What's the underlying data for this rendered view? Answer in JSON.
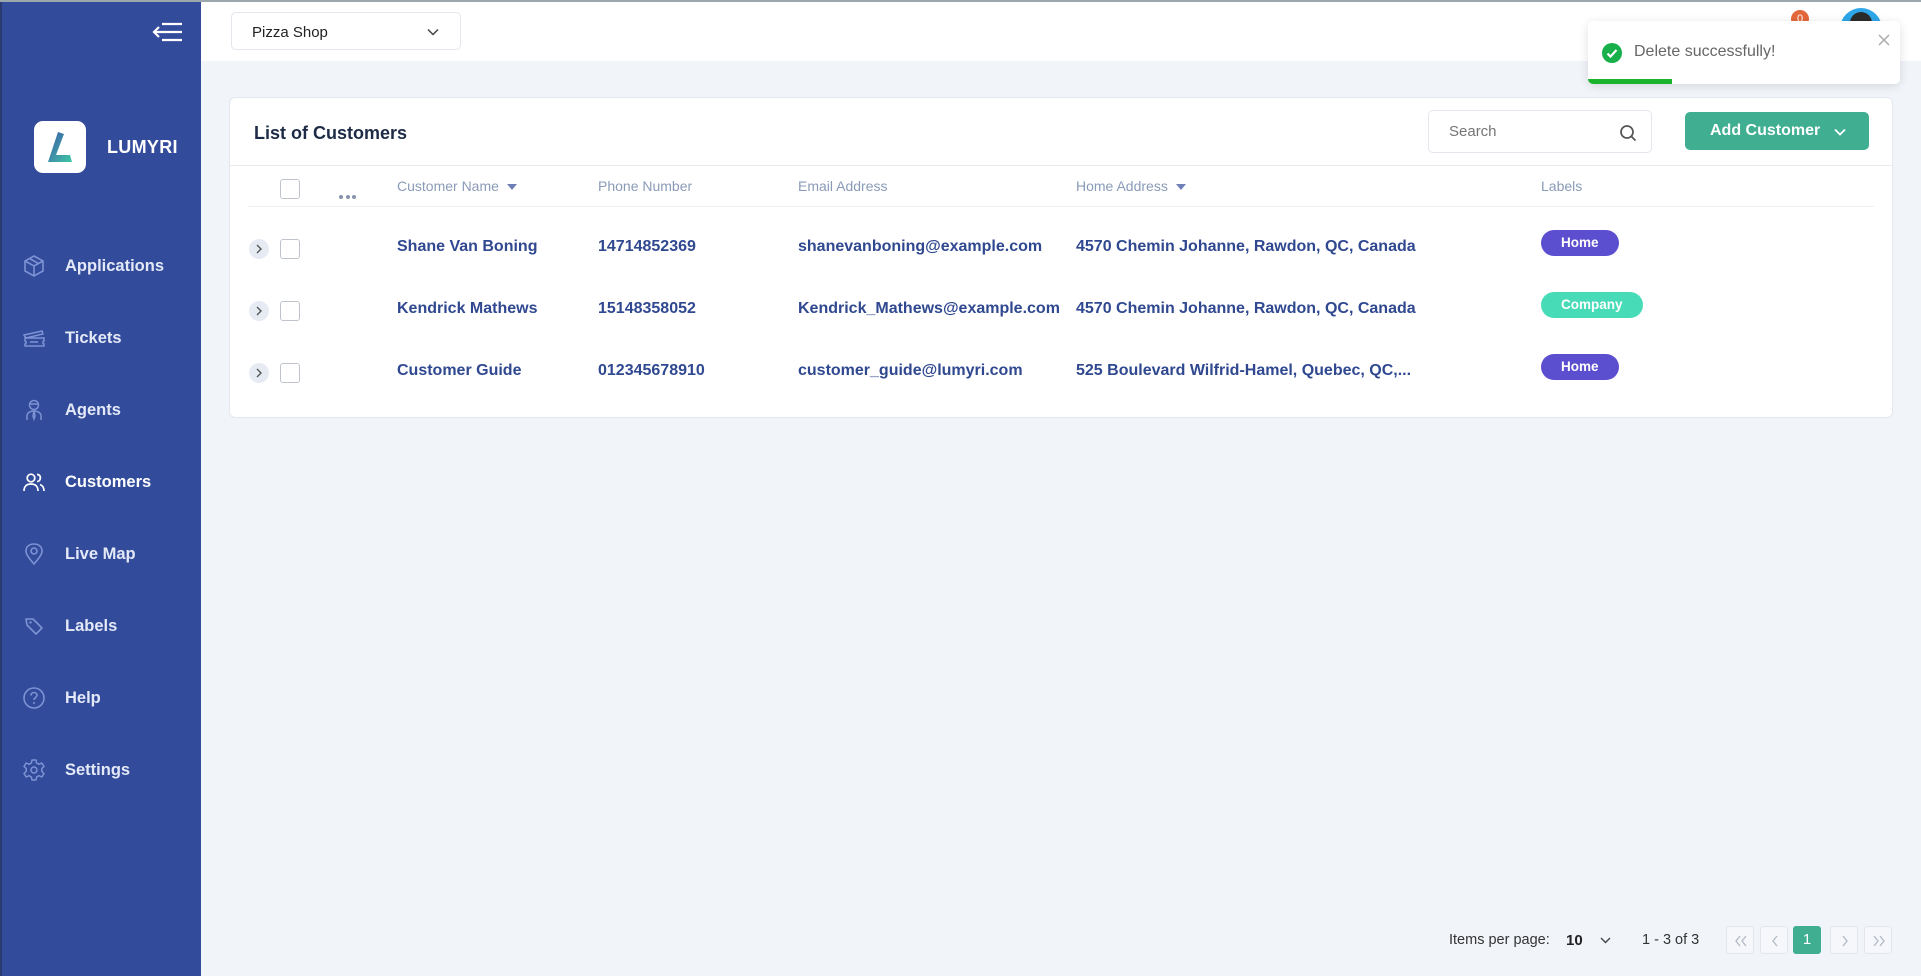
{
  "app": {
    "brand": "LUMYRI"
  },
  "sidebar": {
    "items": [
      {
        "label": "Applications",
        "icon": "box-icon",
        "active": false
      },
      {
        "label": "Tickets",
        "icon": "ticket-icon",
        "active": false
      },
      {
        "label": "Agents",
        "icon": "agent-icon",
        "active": false
      },
      {
        "label": "Customers",
        "icon": "users-icon",
        "active": true
      },
      {
        "label": "Live Map",
        "icon": "map-pin-icon",
        "active": false
      },
      {
        "label": "Labels",
        "icon": "tag-icon",
        "active": false
      },
      {
        "label": "Help",
        "icon": "help-icon",
        "active": false
      },
      {
        "label": "Settings",
        "icon": "gear-icon",
        "active": false
      }
    ]
  },
  "header": {
    "shop_select": "Pizza Shop",
    "notification_count": "0"
  },
  "toast": {
    "message": "Delete successfully!",
    "status": "success",
    "progress": 0.27
  },
  "card": {
    "title": "List of Customers",
    "search_placeholder": "Search",
    "add_button": "Add Customer",
    "columns": {
      "name": "Customer Name",
      "phone": "Phone Number",
      "email": "Email Address",
      "address": "Home Address",
      "labels": "Labels"
    },
    "rows": [
      {
        "name": "Shane Van Boning",
        "phone": "14714852369",
        "email": "shanevanboning@example.com",
        "address": "4570 Chemin Johanne, Rawdon, QC, Canada",
        "label": "Home",
        "label_color": "#5b4fcf"
      },
      {
        "name": "Kendrick Mathews",
        "phone": "15148358052",
        "email": "Kendrick_Mathews@example.com",
        "address": "4570 Chemin Johanne, Rawdon, QC, Canada",
        "label": "Company",
        "label_color": "#47dbb8"
      },
      {
        "name": "Customer Guide",
        "phone": "012345678910",
        "email": "customer_guide@lumyri.com",
        "address": "525 Boulevard Wilfrid-Hamel, Quebec, QC,...",
        "label": "Home",
        "label_color": "#5b4fcf"
      }
    ]
  },
  "pagination": {
    "items_per_page_label": "Items per page:",
    "items_per_page": "10",
    "range": "1 - 3 of 3",
    "current_page": "1"
  },
  "colors": {
    "sidebar": "#324b9b",
    "accent": "#3fae91",
    "success": "#17b04a"
  }
}
